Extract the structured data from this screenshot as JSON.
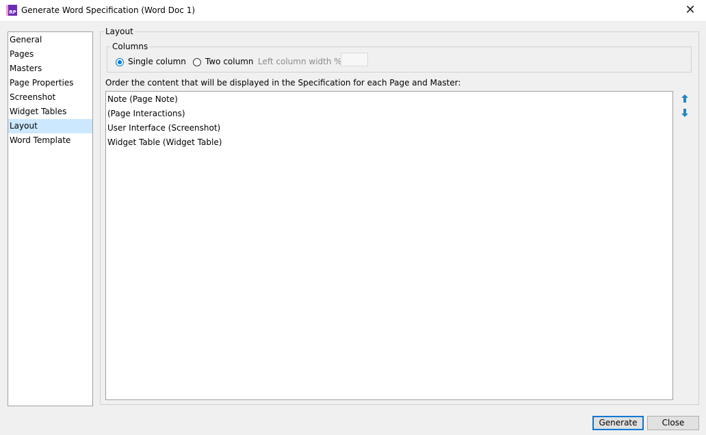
{
  "window": {
    "title": "Generate Word Specification (Word Doc 1)",
    "app_icon_text": "RP",
    "close_glyph": "✕"
  },
  "nav": {
    "items": [
      {
        "label": "General",
        "selected": false
      },
      {
        "label": "Pages",
        "selected": false
      },
      {
        "label": "Masters",
        "selected": false
      },
      {
        "label": "Page Properties",
        "selected": false
      },
      {
        "label": "Screenshot",
        "selected": false
      },
      {
        "label": "Widget Tables",
        "selected": false
      },
      {
        "label": "Layout",
        "selected": true
      },
      {
        "label": "Word Template",
        "selected": false
      }
    ]
  },
  "layout": {
    "group_label": "Layout",
    "columns": {
      "group_label": "Columns",
      "single_label": "Single column",
      "two_label": "Two column",
      "selected": "single",
      "left_width_label": "Left column width %",
      "left_width_value": ""
    },
    "instruction": "Order the content that will be displayed in the Specification for each Page and Master:",
    "content_items": [
      "Note (Page Note)",
      "(Page Interactions)",
      "User Interface (Screenshot)",
      "Widget Table (Widget Table)"
    ],
    "move_up_icon": "arrow-up-icon",
    "move_down_icon": "arrow-down-icon"
  },
  "footer": {
    "generate_label": "Generate",
    "close_label": "Close"
  },
  "colors": {
    "selection": "#cce8ff",
    "accent": "#0078d7",
    "arrow": "#1e88c8"
  }
}
